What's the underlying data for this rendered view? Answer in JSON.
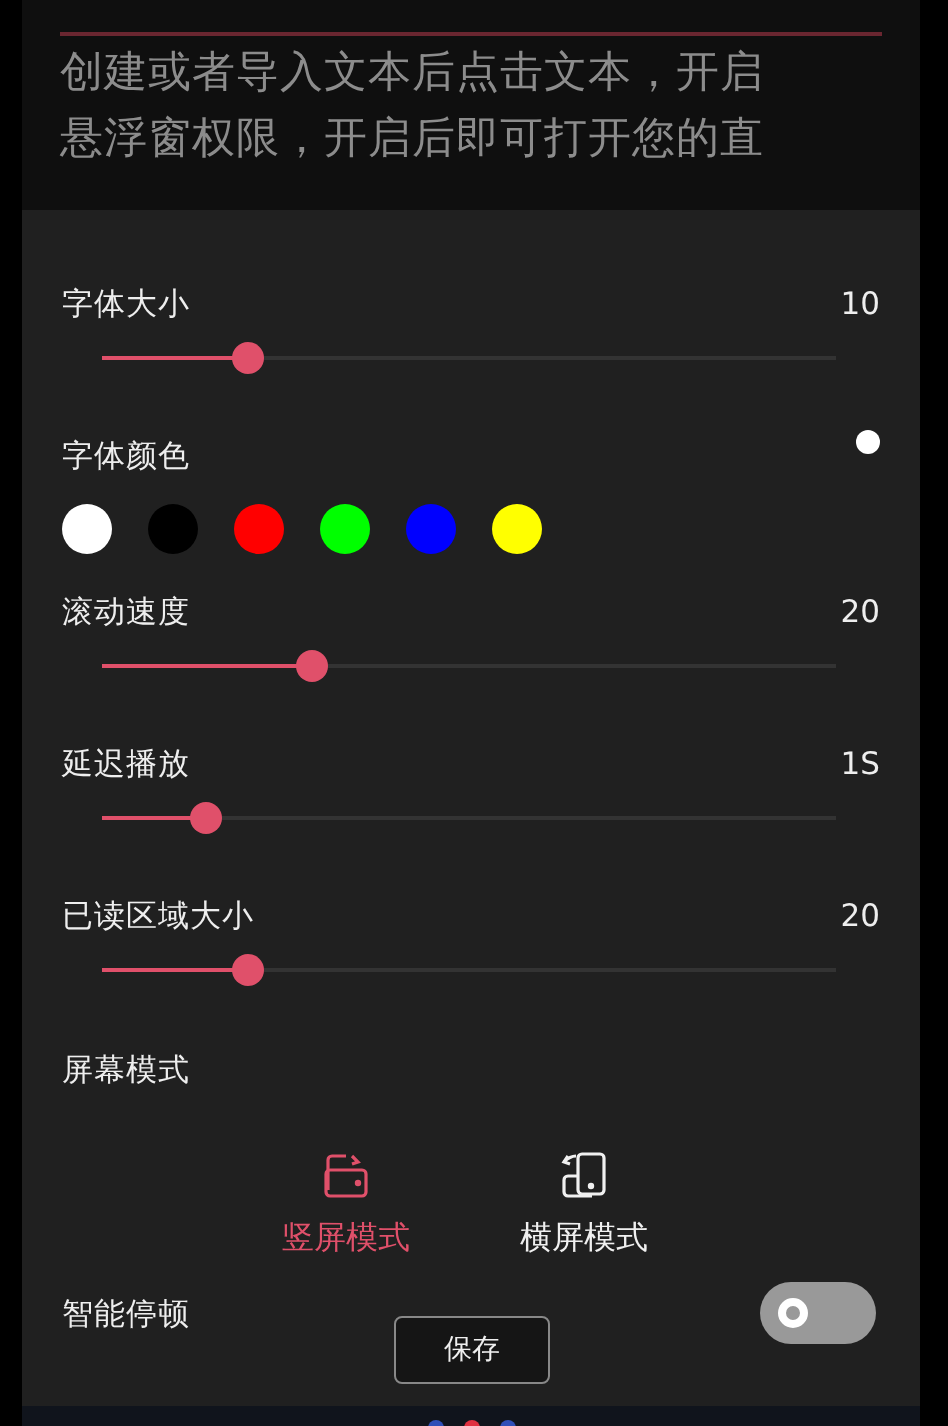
{
  "background_lines": [
    "创建或者导入文本后点击文本，开启",
    "悬浮窗权限，开启后即可打开您的直"
  ],
  "settings": [
    {
      "kind": "slider",
      "label": "字体大小",
      "value": "10",
      "level": 0.2
    },
    {
      "kind": "colors",
      "label": "字体颜色",
      "current": {
        "color": "#ffffff"
      },
      "colors": [
        {
          "color": "#ffffff"
        },
        {
          "color": "#000000"
        },
        {
          "color": "#ff0000"
        },
        {
          "color": "#00ff00"
        },
        {
          "color": "#0000ff"
        },
        {
          "color": "#ffff00"
        }
      ]
    },
    {
      "kind": "slider",
      "label": "滚动速度",
      "value": "20",
      "level": 0.286
    },
    {
      "kind": "slider",
      "label": "延迟播放",
      "value": "1S",
      "level": 0.142
    },
    {
      "kind": "slider",
      "label": "已读区域大小",
      "value": "20",
      "level": 0.2
    },
    {
      "kind": "modes",
      "label": "屏幕模式",
      "modes": [
        {
          "label": "竖屏模式",
          "selected": true
        },
        {
          "label": "横屏模式",
          "selected": false
        }
      ]
    },
    {
      "kind": "toggle",
      "label": "智能停顿",
      "on": false
    }
  ],
  "save_button": "保存"
}
